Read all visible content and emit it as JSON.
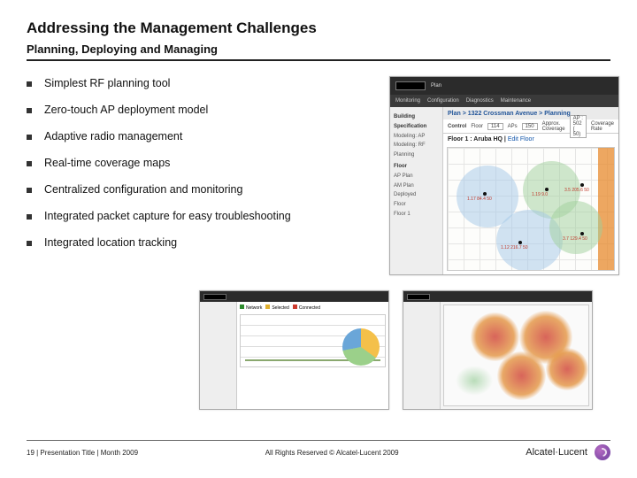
{
  "title": "Addressing the Management Challenges",
  "subtitle": "Planning, Deploying and Managing",
  "bullets": [
    "Simplest RF planning tool",
    "Zero-touch AP deployment model",
    "Adaptive radio management",
    "Real-time coverage maps",
    "Centralized configuration and monitoring",
    "Integrated packet capture for easy troubleshooting",
    "Integrated location tracking"
  ],
  "screenshot_main": {
    "top_tab": "Plan",
    "nav_tabs": [
      "Monitoring",
      "Configuration",
      "Diagnostics",
      "Maintenance"
    ],
    "breadcrumb": "Plan > 1322 Crossman Avenue > Planning",
    "sidebar": {
      "section1": "Building Specification",
      "items1": [
        "Modeling: AP",
        "Modeling: RF",
        "Planning"
      ],
      "section2": "Floor",
      "items2": [
        "AP Plan",
        "AM Plan",
        "Deployed",
        "Floor",
        "Floor 1"
      ]
    },
    "controls": {
      "label": "Control",
      "floor_label": "Floor",
      "floor_value": "114",
      "aps_label": "APs",
      "aps_value": "150",
      "coverage_label": "Approx. Coverage",
      "coverage_value": "AP : 502 ( 50)",
      "rate_label": "Coverage Rate"
    },
    "floor_title": "Floor 1 : Aruba HQ |",
    "floor_edit": "Edit Floor",
    "ap_labels": [
      "1.17 84.4 50",
      "1.19 9.0",
      "3.5 205.6 50",
      "1.12 216.7 50",
      "3.7 129.4 50"
    ]
  },
  "screenshot_small1": {
    "status_labels": [
      "Network",
      "Selected",
      "Connected"
    ]
  },
  "footer": {
    "left": "19 | Presentation Title | Month 2009",
    "center": "All Rights Reserved © Alcatel-Lucent 2009",
    "brand": "Alcatel·Lucent"
  }
}
